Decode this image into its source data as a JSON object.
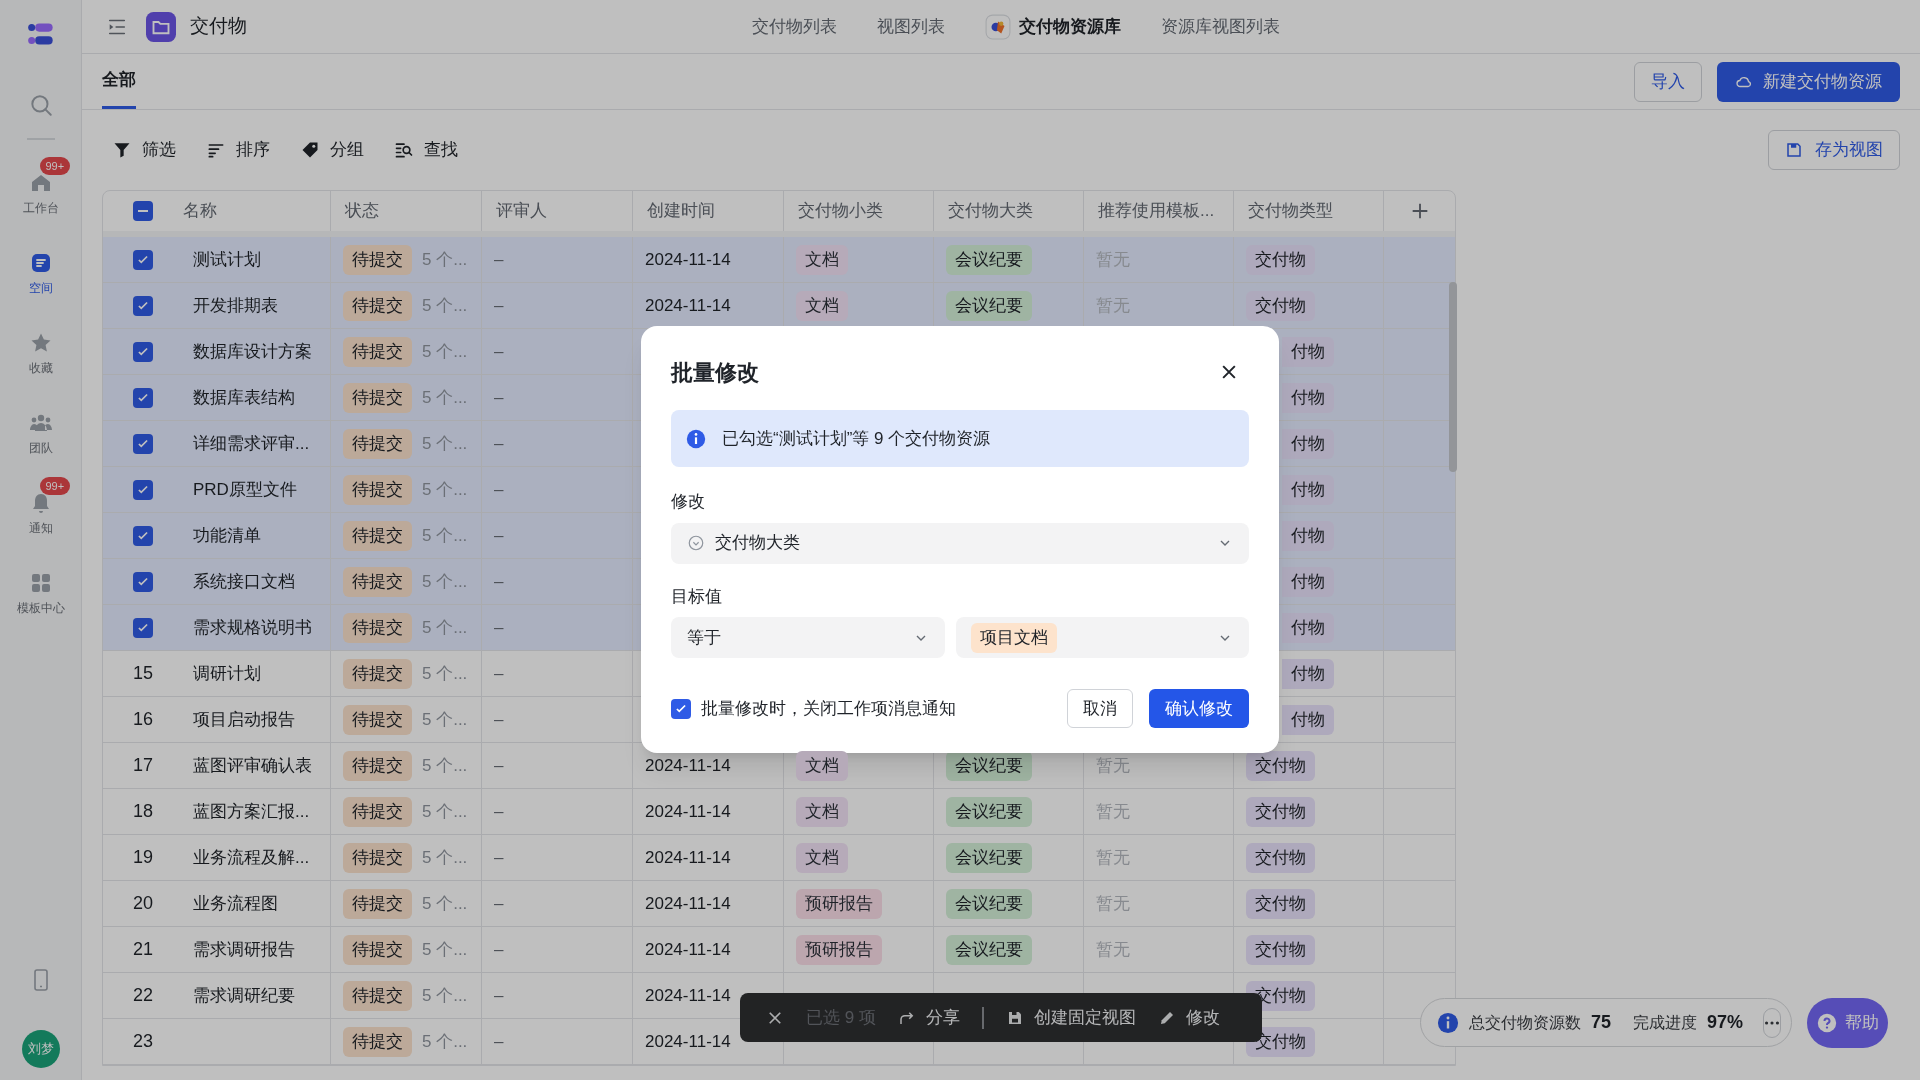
{
  "sidebar": {
    "items": [
      {
        "label": "工作台",
        "badge": "99+",
        "selected": false
      },
      {
        "label": "空间",
        "selected": true
      },
      {
        "label": "收藏",
        "selected": false
      },
      {
        "label": "团队",
        "selected": false
      },
      {
        "label": "通知",
        "badge": "99+",
        "selected": false
      },
      {
        "label": "模板中心",
        "selected": false
      }
    ],
    "avatar": "刘梦"
  },
  "header": {
    "title": "交付物",
    "nav": [
      {
        "label": "交付物列表",
        "selected": false
      },
      {
        "label": "视图列表",
        "selected": false
      },
      {
        "label": "交付物资源库",
        "selected": true
      },
      {
        "label": "资源库视图列表",
        "selected": false
      }
    ]
  },
  "tabs": [
    {
      "label": "全部",
      "selected": true
    }
  ],
  "actions": [
    {
      "label": "导入",
      "kind": "secondary"
    },
    {
      "label": "新建交付物资源",
      "kind": "primary"
    }
  ],
  "toolbar": [
    "筛选",
    "排序",
    "分组",
    "查找"
  ],
  "save_view": "存为视图",
  "table": {
    "select_all_indeterminate": true,
    "columns": [
      "名称",
      "状态",
      "评审人",
      "创建时间",
      "交付物小类",
      "交付物大类",
      "推荐使用模板...",
      "交付物类型"
    ],
    "rows": [
      {
        "selected": true,
        "name": "测试计划",
        "status": "待提交",
        "progress": "5 个...",
        "reviewer": "–",
        "created": "2024-11-14",
        "sub": {
          "text": "文档",
          "color": "#b6aab9"
        },
        "major": "会议纪要",
        "template": "暂无",
        "type": "交付物"
      },
      {
        "selected": true,
        "name": "开发排期表",
        "status": "待提交",
        "progress": "5 个...",
        "reviewer": "–",
        "created": "2024-11-14",
        "sub": {
          "text": "文档",
          "color": "#b6aab9"
        },
        "major": "会议纪要",
        "template": "暂无",
        "type": "交付物"
      },
      {
        "selected": true,
        "name": "数据库设计方案",
        "status": "待提交",
        "progress": "5 个...",
        "reviewer": "–",
        "type": "付物"
      },
      {
        "selected": true,
        "name": "数据库表结构",
        "status": "待提交",
        "progress": "5 个...",
        "reviewer": "–",
        "type": "付物"
      },
      {
        "selected": true,
        "name": "详细需求评审...",
        "status": "待提交",
        "progress": "5 个...",
        "reviewer": "–",
        "type": "付物"
      },
      {
        "selected": true,
        "name": "PRD原型文件",
        "status": "待提交",
        "progress": "5 个...",
        "reviewer": "–",
        "type": "付物"
      },
      {
        "selected": true,
        "name": "功能清单",
        "status": "待提交",
        "progress": "5 个...",
        "reviewer": "–",
        "type": "付物"
      },
      {
        "selected": true,
        "name": "系统接口文档",
        "status": "待提交",
        "progress": "5 个...",
        "reviewer": "–",
        "type": "付物"
      },
      {
        "selected": true,
        "name": "需求规格说明书",
        "status": "待提交",
        "progress": "5 个...",
        "reviewer": "–",
        "type": "付物"
      },
      {
        "selected": false,
        "index": "15",
        "name": "调研计划",
        "status": "待提交",
        "progress": "5 个...",
        "reviewer": "–",
        "type": "付物"
      },
      {
        "selected": false,
        "index": "16",
        "name": "项目启动报告",
        "status": "待提交",
        "progress": "5 个...",
        "reviewer": "–",
        "type": "付物"
      },
      {
        "selected": false,
        "index": "17",
        "name": "蓝图评审确认表",
        "status": "待提交",
        "progress": "5 个...",
        "reviewer": "–",
        "created": "2024-11-14",
        "sub": {
          "text": "文档",
          "color": "#b6aab9"
        },
        "major": "会议纪要",
        "template": "暂无",
        "type": "交付物"
      },
      {
        "selected": false,
        "index": "18",
        "name": "蓝图方案汇报...",
        "status": "待提交",
        "progress": "5 个...",
        "reviewer": "–",
        "created": "2024-11-14",
        "sub": {
          "text": "文档",
          "color": "#b6aab9"
        },
        "major": "会议纪要",
        "template": "暂无",
        "type": "交付物"
      },
      {
        "selected": false,
        "index": "19",
        "name": "业务流程及解...",
        "status": "待提交",
        "progress": "5 个...",
        "reviewer": "–",
        "created": "2024-11-14",
        "sub": {
          "text": "文档",
          "color": "#b6aab9"
        },
        "major": "会议纪要",
        "template": "暂无",
        "type": "交付物"
      },
      {
        "selected": false,
        "index": "20",
        "name": "业务流程图",
        "status": "待提交",
        "progress": "5 个...",
        "reviewer": "–",
        "created": "2024-11-14",
        "sub": {
          "text": "预研报告",
          "color": "#bca6ae"
        },
        "major": "会议纪要",
        "template": "暂无",
        "type": "交付物"
      },
      {
        "selected": false,
        "index": "21",
        "name": "需求调研报告",
        "status": "待提交",
        "progress": "5 个...",
        "reviewer": "–",
        "created": "2024-11-14",
        "sub": {
          "text": "预研报告",
          "color": "#bca6ae"
        },
        "major": "会议纪要",
        "template": "暂无",
        "type": "交付物"
      },
      {
        "selected": false,
        "index": "22",
        "name": "需求调研纪要",
        "status": "待提交",
        "progress": "5 个...",
        "reviewer": "–",
        "created": "2024-11-14",
        "type": "交付物"
      },
      {
        "selected": false,
        "index": "23",
        "status": "待提交",
        "progress": "5 个...",
        "reviewer": "–",
        "created": "2024-11-14",
        "type": "交付物"
      }
    ]
  },
  "selection_bar": {
    "count": "已选 9 项",
    "actions": [
      "分享",
      "创建固定视图",
      "修改"
    ]
  },
  "stats": [
    {
      "label": "总交付物资源数",
      "value": "75"
    },
    {
      "label": "完成进度",
      "value": "97%"
    }
  ],
  "help": "帮助",
  "dialog": {
    "title": "批量修改",
    "notice": "已勾选“测试计划”等 9 个交付物资源",
    "field_label": "修改",
    "field_value": "交付物大类",
    "target_label": "目标值",
    "operator": "等于",
    "target_value": "项目文档",
    "mute": {
      "label": "批量修改时，关闭工作项消息通知",
      "checked": true
    },
    "buttons": [
      {
        "label": "取消",
        "kind": "secondary"
      },
      {
        "label": "确认修改",
        "kind": "primary"
      }
    ]
  }
}
